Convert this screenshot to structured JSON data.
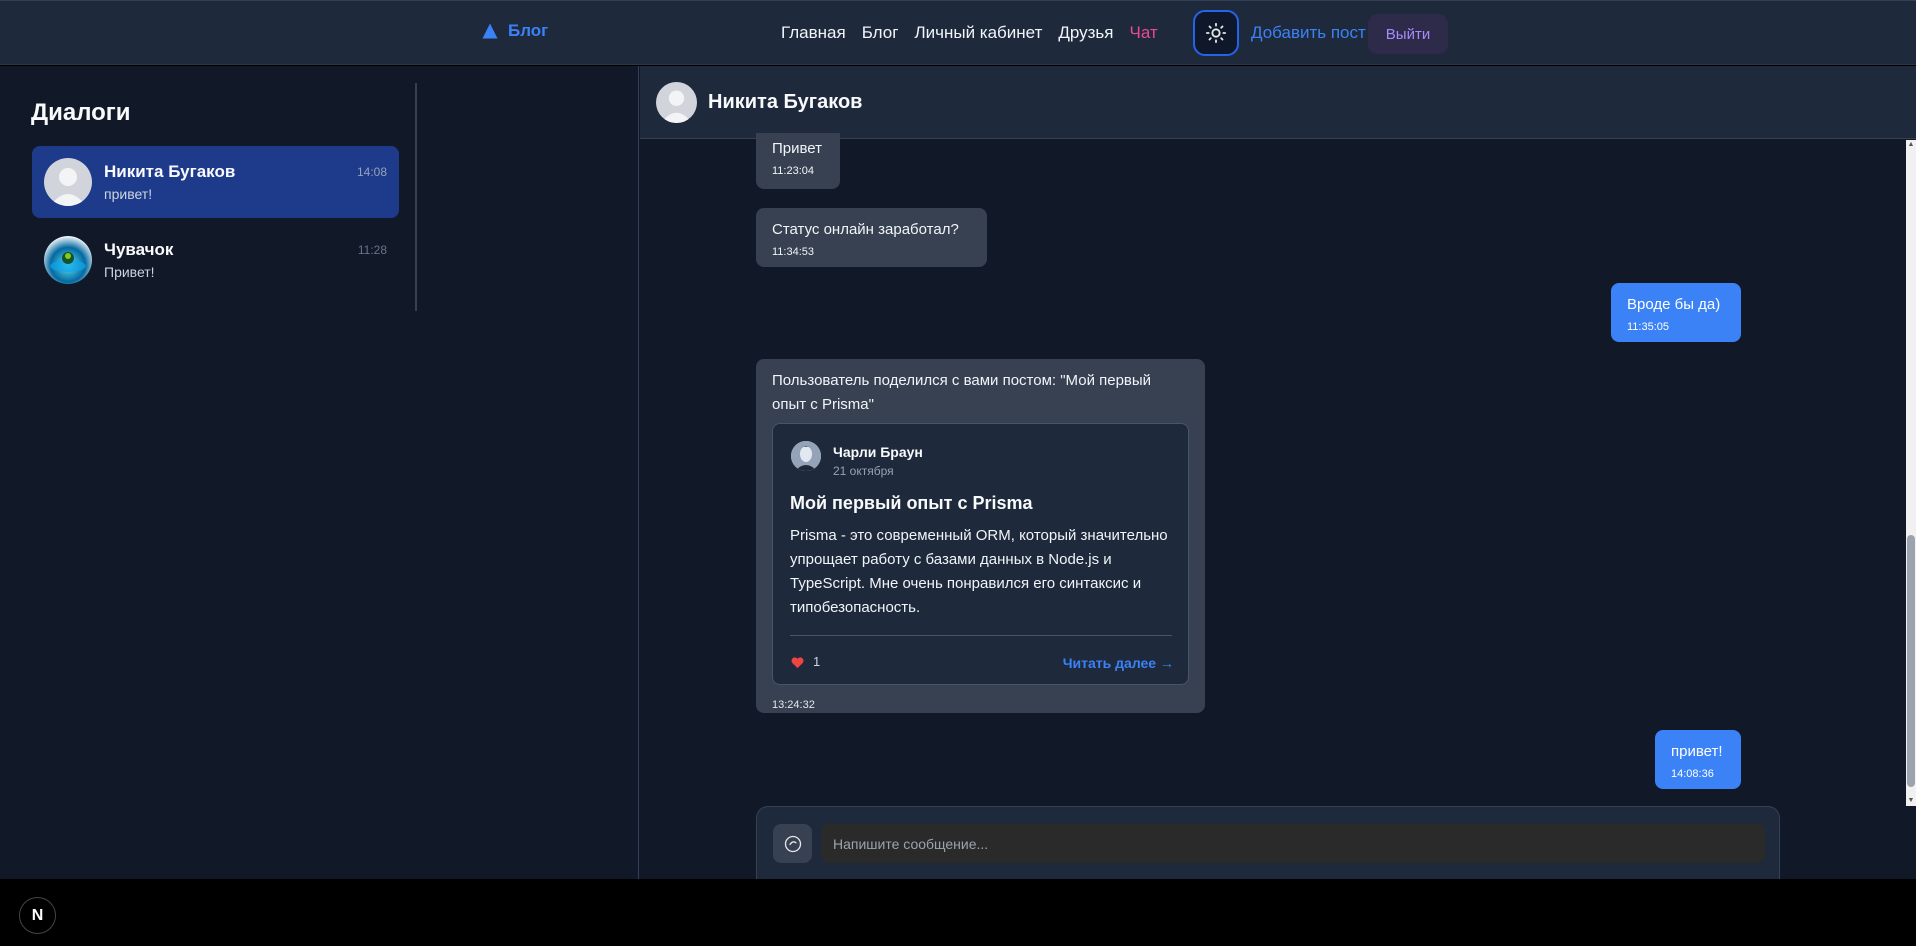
{
  "header": {
    "logo_label": "Блог",
    "nav": [
      {
        "label": "Главная"
      },
      {
        "label": "Блог"
      },
      {
        "label": "Личный кабинет"
      },
      {
        "label": "Друзья"
      },
      {
        "label": "Чат"
      }
    ],
    "active_nav": "Чат",
    "add_post_label": "Добавить пост",
    "logout_label": "Выйти",
    "theme_icon": "sun-icon"
  },
  "sidebar": {
    "title": "Диалоги",
    "dialogs": [
      {
        "name": "Никита Бугаков",
        "preview": "привет!",
        "time": "14:08",
        "active": true
      },
      {
        "name": "Чувачок",
        "preview": "Привет!",
        "time": "11:28",
        "active": false
      }
    ]
  },
  "chat": {
    "contact_name": "Никита Бугаков",
    "messages": [
      {
        "direction": "in",
        "text": "Привет",
        "time": "11:23:04"
      },
      {
        "direction": "in",
        "text": "Статус онлайн заработал?",
        "time": "11:34:53"
      },
      {
        "direction": "out",
        "text": "Вроде бы да)",
        "time": "11:35:05"
      },
      {
        "direction": "in",
        "text": "Пользователь поделился с вами постом: \"Мой первый опыт с Prisma\"",
        "time": "13:24:32"
      },
      {
        "direction": "out",
        "text": "привет!",
        "time": "14:08:36"
      }
    ],
    "shared_post": {
      "author": "Чарли Браун",
      "date": "21 октября",
      "title": "Мой первый опыт с Prisma",
      "text": "Prisma - это современный ORM, который значительно упрощает работу с базами данных в Node.js и TypeScript. Мне очень понравился его синтаксис и типобезопасность.",
      "likes": "1",
      "read_more": "Читать далее →"
    },
    "composer": {
      "placeholder": "Напишите сообщение..."
    }
  },
  "colors": {
    "accent": "#3b82f6",
    "active_nav": "#ec4899",
    "outgoing_bubble": "#3b82f6",
    "incoming_bubble": "#374151",
    "active_dialog": "#1e3a8a"
  },
  "dev_badge": "N"
}
